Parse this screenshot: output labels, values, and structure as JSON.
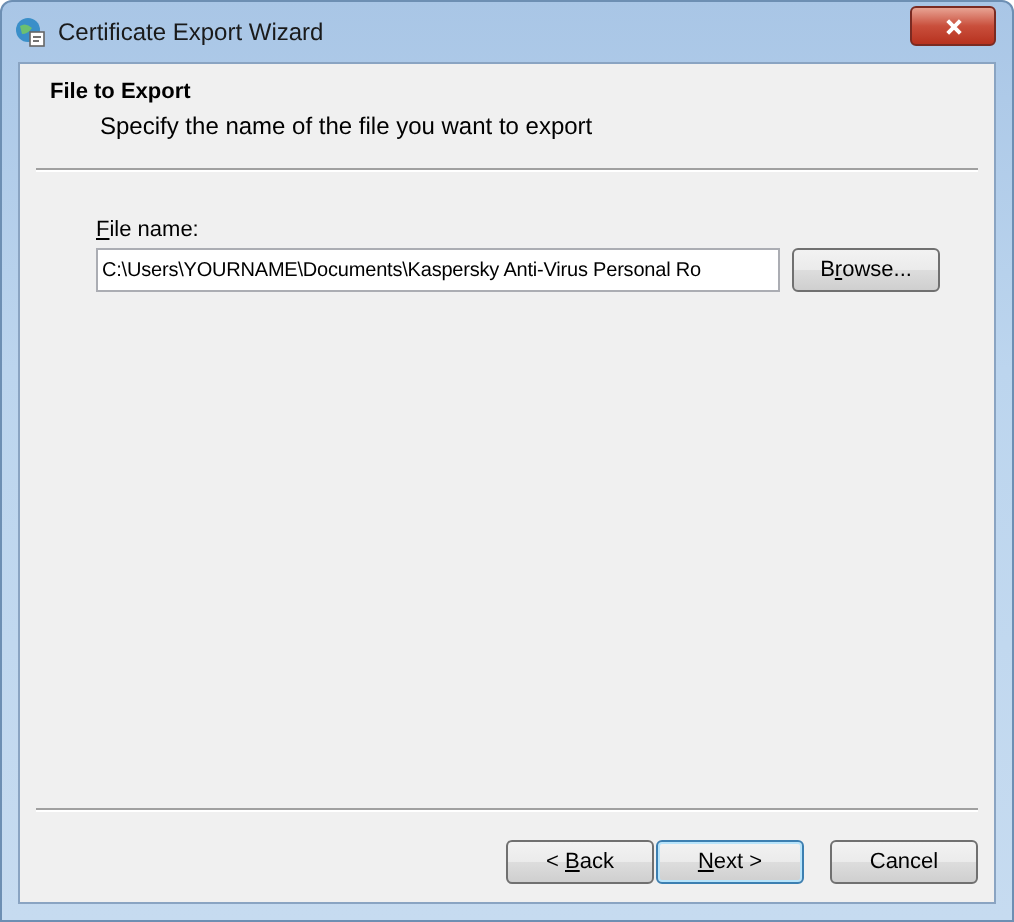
{
  "window": {
    "title": "Certificate Export Wizard"
  },
  "header": {
    "title": "File to Export",
    "subtitle": "Specify the name of the file you want to export"
  },
  "file_name": {
    "label": {
      "key": "F",
      "after": "ile name:"
    },
    "value": "C:\\Users\\YOURNAME\\Documents\\Kaspersky Anti-Virus Personal Ro"
  },
  "browse_button": {
    "before": "B",
    "key": "r",
    "after": "owse..."
  },
  "buttons": [
    {
      "before": "< ",
      "key": "B",
      "after": "ack",
      "default": false
    },
    {
      "key": "N",
      "after": "ext >",
      "default": true
    },
    {
      "before": "Cancel",
      "default": false
    }
  ]
}
